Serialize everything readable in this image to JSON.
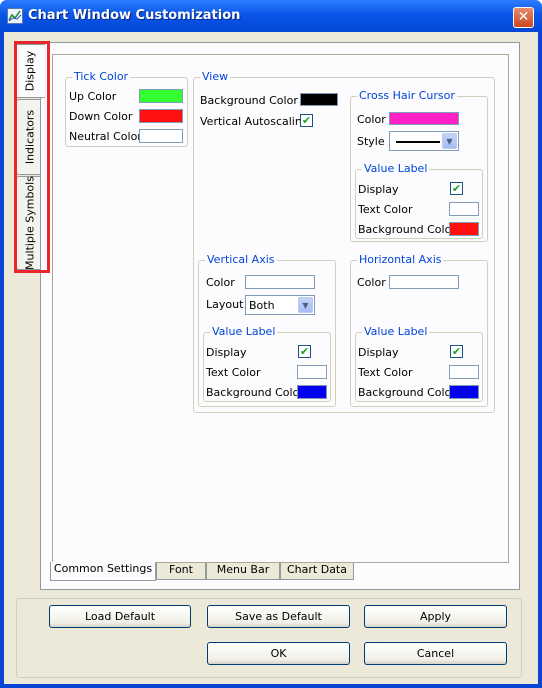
{
  "window": {
    "title": "Chart Window Customization",
    "close_symbol": "✕"
  },
  "side_tabs": [
    {
      "label": "Display"
    },
    {
      "label": "Indicators"
    },
    {
      "label": "Multiple Symbols"
    }
  ],
  "bottom_tabs": [
    {
      "label": "Common Settings"
    },
    {
      "label": "Font"
    },
    {
      "label": "Menu Bar"
    },
    {
      "label": "Chart Data"
    }
  ],
  "tick_color": {
    "legend": "Tick Color",
    "up_label": "Up Color",
    "up_color": "#33ff33",
    "down_label": "Down Color",
    "down_color": "#ff1111",
    "neutral_label": "Neutral Color",
    "neutral_color": "#ffffff"
  },
  "view": {
    "legend": "View",
    "bg_label": "Background Color",
    "bg_color": "#000000",
    "autoscale_label": "Vertical Autoscaling",
    "autoscale_checked": true
  },
  "cross_hair": {
    "legend": "Cross Hair Cursor",
    "color_label": "Color",
    "color": "#ff1fc4",
    "style_label": "Style",
    "value_label": {
      "legend": "Value Label",
      "display_label": "Display",
      "display_checked": true,
      "text_label": "Text Color",
      "text_color": "#ffffff",
      "bg_label": "Background Color",
      "bg_color": "#ff1111"
    }
  },
  "vertical_axis": {
    "legend": "Vertical Axis",
    "color_label": "Color",
    "color": "#ffffff",
    "layout_label": "Layout",
    "layout_value": "Both",
    "value_label": {
      "legend": "Value Label",
      "display_label": "Display",
      "display_checked": true,
      "text_label": "Text Color",
      "text_color": "#ffffff",
      "bg_label": "Background Color",
      "bg_color": "#0000ee"
    }
  },
  "horizontal_axis": {
    "legend": "Horizontal Axis",
    "color_label": "Color",
    "color": "#ffffff",
    "value_label": {
      "legend": "Value Label",
      "display_label": "Display",
      "display_checked": true,
      "text_label": "Text Color",
      "text_color": "#ffffff",
      "bg_label": "Background Color",
      "bg_color": "#0000ee"
    }
  },
  "buttons": {
    "load_default": "Load Default",
    "save_default": "Save as Default",
    "apply": "Apply",
    "ok": "OK",
    "cancel": "Cancel"
  },
  "checkmark": "✔",
  "arrow": "▼"
}
